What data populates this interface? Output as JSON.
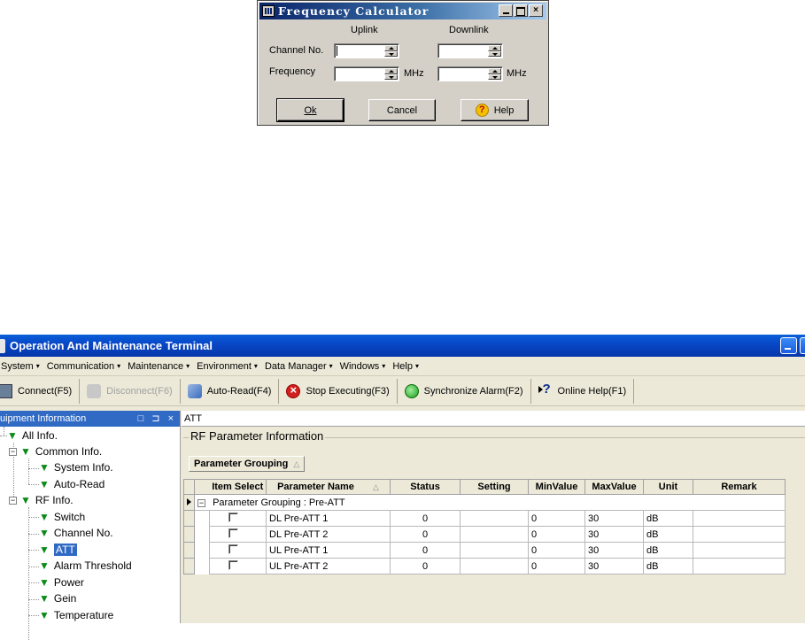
{
  "dialog": {
    "title": "Frequency Calculator",
    "col_uplink": "Uplink",
    "col_downlink": "Downlink",
    "label_channel": "Channel No.",
    "label_frequency": "Frequency",
    "unit_uplink": "MHz",
    "unit_downlink": "MHz",
    "uplink_channel_value": "",
    "downlink_channel_value": "",
    "uplink_frequency_value": "",
    "downlink_frequency_value": "",
    "ok_label": "Ok",
    "cancel_label": "Cancel",
    "help_label": "Help"
  },
  "main": {
    "title": "Operation And Maintenance Terminal",
    "menu": [
      {
        "label": "System",
        "mnemonic_first": false
      },
      {
        "label": "Communication",
        "mnemonic_first": true
      },
      {
        "label": "Maintenance",
        "mnemonic_first": true
      },
      {
        "label": "Environment",
        "mnemonic_first": false
      },
      {
        "label": "Data Manager",
        "mnemonic_first": true
      },
      {
        "label": "Windows",
        "mnemonic_first": true
      },
      {
        "label": "Help",
        "mnemonic_first": false
      }
    ],
    "toolbar": {
      "connect": "Connect(F5)",
      "disconnect": "Disconnect(F6)",
      "autoread": "Auto-Read(F4)",
      "stop": "Stop Executing(F3)",
      "sync": "Synchronize Alarm(F2)",
      "online_help": "Online Help(F1)"
    },
    "panel_title": "uipment Information",
    "panel_buttons": "□ ⊐ ×",
    "tree": {
      "all_info": "All Info.",
      "common_info": "Common Info.",
      "system_info": "System Info.",
      "auto_read": "Auto-Read",
      "rf_info": "RF Info.",
      "switch": "Switch",
      "channel_no": "Channel No.",
      "att": "ATT",
      "alarm_threshold": "Alarm Threshold",
      "power": "Power",
      "gein": "Gein",
      "temperature": "Temperature"
    },
    "path": "ATT",
    "section_title": "RF Parameter Information",
    "group_button": "Parameter Grouping",
    "table": {
      "headers": [
        "Item Select",
        "Parameter Name",
        "Status",
        "Setting",
        "MinValue",
        "MaxValue",
        "Unit",
        "Remark"
      ],
      "group_label": "Parameter Grouping : Pre-ATT",
      "rows": [
        {
          "name": "DL Pre-ATT 1",
          "status": "0",
          "setting": "",
          "min": "0",
          "max": "30",
          "unit": "dB",
          "remark": ""
        },
        {
          "name": "DL Pre-ATT 2",
          "status": "0",
          "setting": "",
          "min": "0",
          "max": "30",
          "unit": "dB",
          "remark": ""
        },
        {
          "name": "UL Pre-ATT 1",
          "status": "0",
          "setting": "",
          "min": "0",
          "max": "30",
          "unit": "dB",
          "remark": ""
        },
        {
          "name": "UL Pre-ATT 2",
          "status": "0",
          "setting": "",
          "min": "0",
          "max": "30",
          "unit": "dB",
          "remark": ""
        }
      ]
    }
  },
  "colors": {
    "dialog_title_start": "#0a246a",
    "main_title": "#0848c8",
    "selection": "#316ac5",
    "tree_icon": "#0a8a1a"
  }
}
